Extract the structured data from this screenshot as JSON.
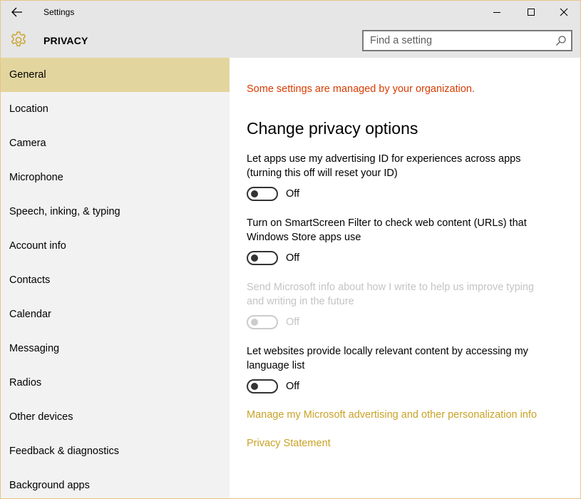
{
  "window": {
    "title": "Settings",
    "back_icon": "arrow-left-icon",
    "controls": [
      "minimize-icon",
      "maximize-icon",
      "close-icon"
    ]
  },
  "header": {
    "icon": "gear-icon",
    "title": "PRIVACY",
    "search_placeholder": "Find a setting",
    "search_value": ""
  },
  "colors": {
    "accent": "#c9a227",
    "selected_nav": "#e3d59e",
    "managed_text": "#d83b01"
  },
  "sidebar": {
    "items": [
      {
        "label": "General",
        "selected": true
      },
      {
        "label": "Location",
        "selected": false
      },
      {
        "label": "Camera",
        "selected": false
      },
      {
        "label": "Microphone",
        "selected": false
      },
      {
        "label": "Speech, inking, & typing",
        "selected": false
      },
      {
        "label": "Account info",
        "selected": false
      },
      {
        "label": "Contacts",
        "selected": false
      },
      {
        "label": "Calendar",
        "selected": false
      },
      {
        "label": "Messaging",
        "selected": false
      },
      {
        "label": "Radios",
        "selected": false
      },
      {
        "label": "Other devices",
        "selected": false
      },
      {
        "label": "Feedback & diagnostics",
        "selected": false
      },
      {
        "label": "Background apps",
        "selected": false
      }
    ]
  },
  "main": {
    "managed_notice": "Some settings are managed by your organization.",
    "heading": "Change privacy options",
    "options": [
      {
        "line1": "Let apps use my advertising ID for experiences across apps",
        "line2": "(turning this off will reset your ID)",
        "state": "Off",
        "enabled": true
      },
      {
        "line1": "Turn on SmartScreen Filter to check web content (URLs) that",
        "line2": "Windows Store apps use",
        "state": "Off",
        "enabled": true
      },
      {
        "line1": "Send Microsoft info about how I write to help us improve typing",
        "line2": "and writing in the future",
        "state": "Off",
        "enabled": false
      },
      {
        "line1": "Let websites provide locally relevant content by accessing my",
        "line2": "language list",
        "state": "Off",
        "enabled": true
      }
    ],
    "links": {
      "manage": "Manage my Microsoft advertising and other personalization info",
      "privacy": "Privacy Statement"
    }
  }
}
